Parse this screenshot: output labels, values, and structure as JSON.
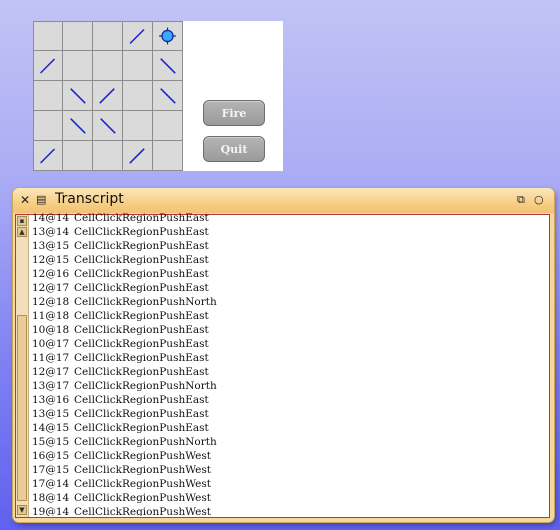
{
  "game": {
    "grid": [
      [
        "",
        "",
        "",
        "/",
        "target"
      ],
      [
        "/",
        "",
        "",
        "",
        "\\"
      ],
      [
        "",
        "\\",
        "/",
        "",
        "\\"
      ],
      [
        "",
        "\\",
        "\\",
        "",
        ""
      ],
      [
        "/",
        "",
        "",
        "/",
        ""
      ]
    ],
    "fire_label": "Fire",
    "quit_label": "Quit",
    "mirror_color": "#1a22c8",
    "target_color": "#3aa8ff"
  },
  "transcript": {
    "title": "Transcript",
    "icons": {
      "close": "close-icon",
      "menu": "menu-icon",
      "collapse": "collapse-icon",
      "expand": "expand-icon"
    },
    "lines": [
      {
        "coord": "14@14",
        "msg": "CellClickRegionPushEast"
      },
      {
        "coord": "13@14",
        "msg": "CellClickRegionPushEast"
      },
      {
        "coord": "13@15",
        "msg": "CellClickRegionPushEast"
      },
      {
        "coord": "12@15",
        "msg": "CellClickRegionPushEast"
      },
      {
        "coord": "12@16",
        "msg": "CellClickRegionPushEast"
      },
      {
        "coord": "12@17",
        "msg": "CellClickRegionPushEast"
      },
      {
        "coord": "12@18",
        "msg": "CellClickRegionPushNorth"
      },
      {
        "coord": "11@18",
        "msg": "CellClickRegionPushEast"
      },
      {
        "coord": "10@18",
        "msg": "CellClickRegionPushEast"
      },
      {
        "coord": "10@17",
        "msg": "CellClickRegionPushEast"
      },
      {
        "coord": "11@17",
        "msg": "CellClickRegionPushEast"
      },
      {
        "coord": "12@17",
        "msg": "CellClickRegionPushEast"
      },
      {
        "coord": "13@17",
        "msg": "CellClickRegionPushNorth"
      },
      {
        "coord": "13@16",
        "msg": "CellClickRegionPushEast"
      },
      {
        "coord": "13@15",
        "msg": "CellClickRegionPushEast"
      },
      {
        "coord": "14@15",
        "msg": "CellClickRegionPushEast"
      },
      {
        "coord": "15@15",
        "msg": "CellClickRegionPushNorth"
      },
      {
        "coord": "16@15",
        "msg": "CellClickRegionPushWest"
      },
      {
        "coord": "17@15",
        "msg": "CellClickRegionPushWest"
      },
      {
        "coord": "17@14",
        "msg": "CellClickRegionPushWest"
      },
      {
        "coord": "18@14",
        "msg": "CellClickRegionPushWest"
      },
      {
        "coord": "19@14",
        "msg": "CellClickRegionPushWest"
      }
    ]
  }
}
